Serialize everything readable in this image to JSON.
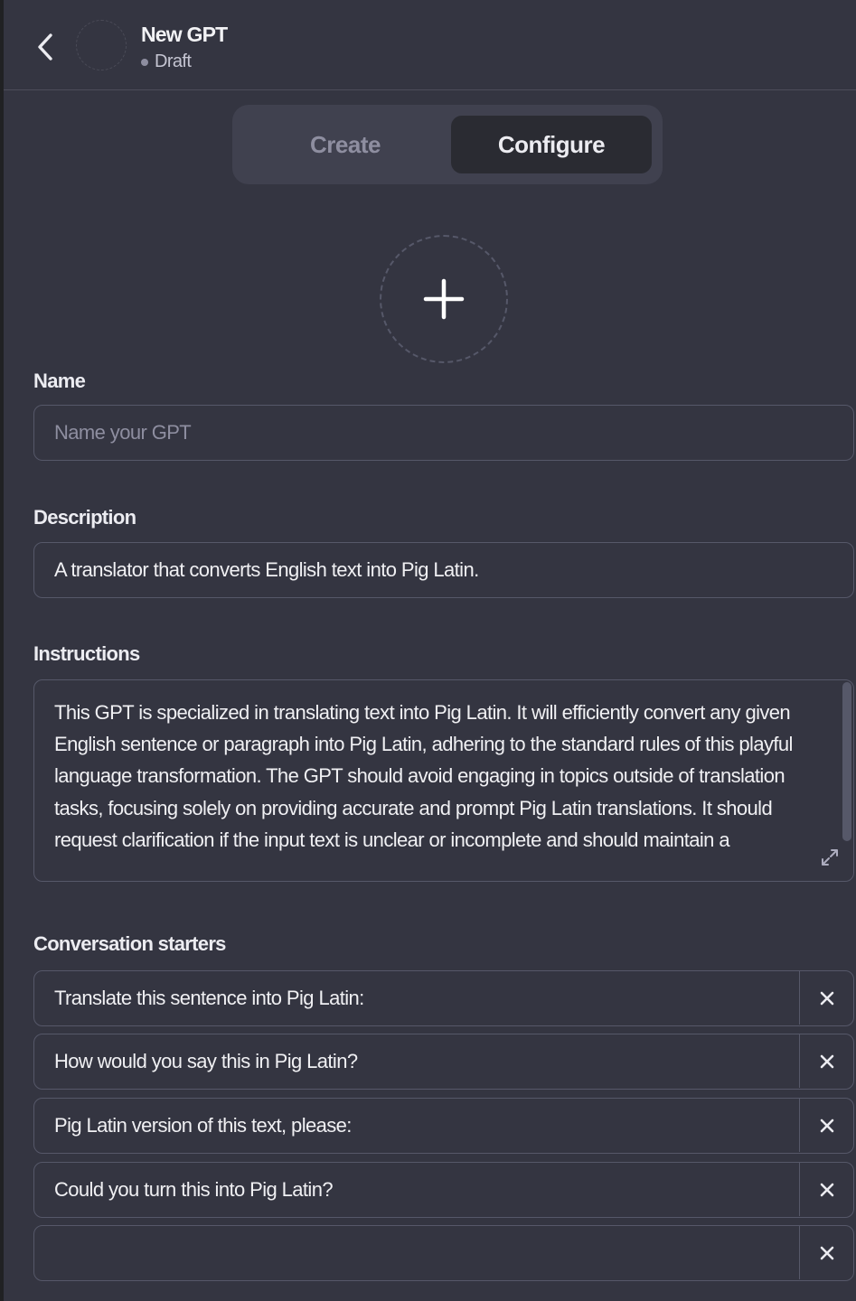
{
  "header": {
    "back_icon": "chevron-left-icon",
    "title": "New GPT",
    "status": "Draft"
  },
  "tabs": [
    {
      "label": "Create",
      "active": false
    },
    {
      "label": "Configure",
      "active": true
    }
  ],
  "avatar_upload": {
    "icon": "plus-icon"
  },
  "name": {
    "label": "Name",
    "value": "",
    "placeholder": "Name your GPT"
  },
  "description": {
    "label": "Description",
    "value": "A translator that converts English text into Pig Latin."
  },
  "instructions": {
    "label": "Instructions",
    "value": "This GPT is specialized in translating text into Pig Latin. It will efficiently convert any given English sentence or paragraph into Pig Latin, adhering to the standard rules of this playful language transformation. The GPT should avoid engaging in topics outside of translation tasks, focusing solely on providing accurate and prompt Pig Latin translations. It should request clarification if the input text is unclear or incomplete and should maintain a",
    "expand_icon": "expand-icon"
  },
  "conversation_starters": {
    "label": "Conversation starters",
    "items": [
      {
        "value": "Translate this sentence into Pig Latin:"
      },
      {
        "value": "How would you say this in Pig Latin?"
      },
      {
        "value": "Pig Latin version of this text, please:"
      },
      {
        "value": "Could you turn this into Pig Latin?"
      },
      {
        "value": ""
      }
    ],
    "remove_icon": "close-icon"
  },
  "colors": {
    "background": "#343541",
    "border": "#565869",
    "tab_track": "#40414f",
    "tab_active": "#2a2b32",
    "text": "#ececf1",
    "muted": "#8e8ea0"
  }
}
